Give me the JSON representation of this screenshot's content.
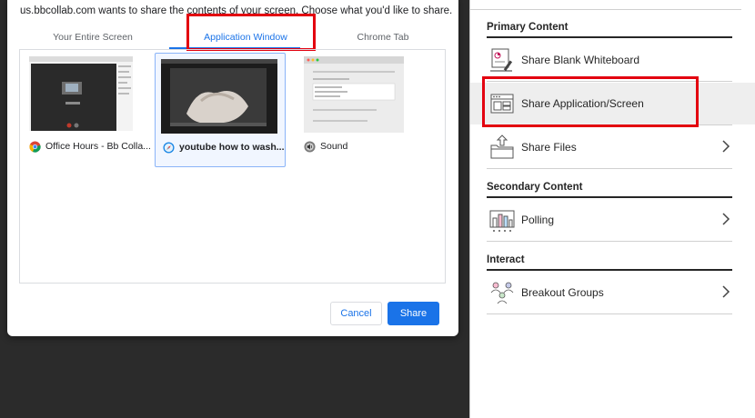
{
  "dialog": {
    "prompt": "us.bbcollab.com wants to share the contents of your screen. Choose what you'd like to share.",
    "tabs": [
      {
        "label": "Your Entire Screen",
        "active": false
      },
      {
        "label": "Application Window",
        "active": true
      },
      {
        "label": "Chrome Tab",
        "active": false
      }
    ],
    "windows": [
      {
        "label": "Office Hours - Bb Colla...",
        "icon": "chrome-icon",
        "selected": false
      },
      {
        "label": "youtube how to wash...",
        "icon": "safari-icon",
        "selected": true
      },
      {
        "label": "Sound",
        "icon": "sound-preferences-icon",
        "selected": false
      }
    ],
    "cancel_label": "Cancel",
    "share_label": "Share"
  },
  "panel": {
    "sections": [
      {
        "title": "Primary Content"
      },
      {
        "title": "Secondary Content"
      },
      {
        "title": "Interact"
      }
    ],
    "items": [
      {
        "label": "Share Blank Whiteboard",
        "icon": "whiteboard-icon",
        "has_chevron": false
      },
      {
        "label": "Share Application/Screen",
        "icon": "application-window-icon",
        "has_chevron": false,
        "active": true
      },
      {
        "label": "Share Files",
        "icon": "share-files-icon",
        "has_chevron": true
      },
      {
        "label": "Polling",
        "icon": "polling-icon",
        "has_chevron": true
      },
      {
        "label": "Breakout Groups",
        "icon": "breakout-groups-icon",
        "has_chevron": true
      }
    ]
  },
  "colors": {
    "accent": "#1a73e8",
    "highlight": "#e3000f",
    "backdrop": "#2b2b2b"
  }
}
